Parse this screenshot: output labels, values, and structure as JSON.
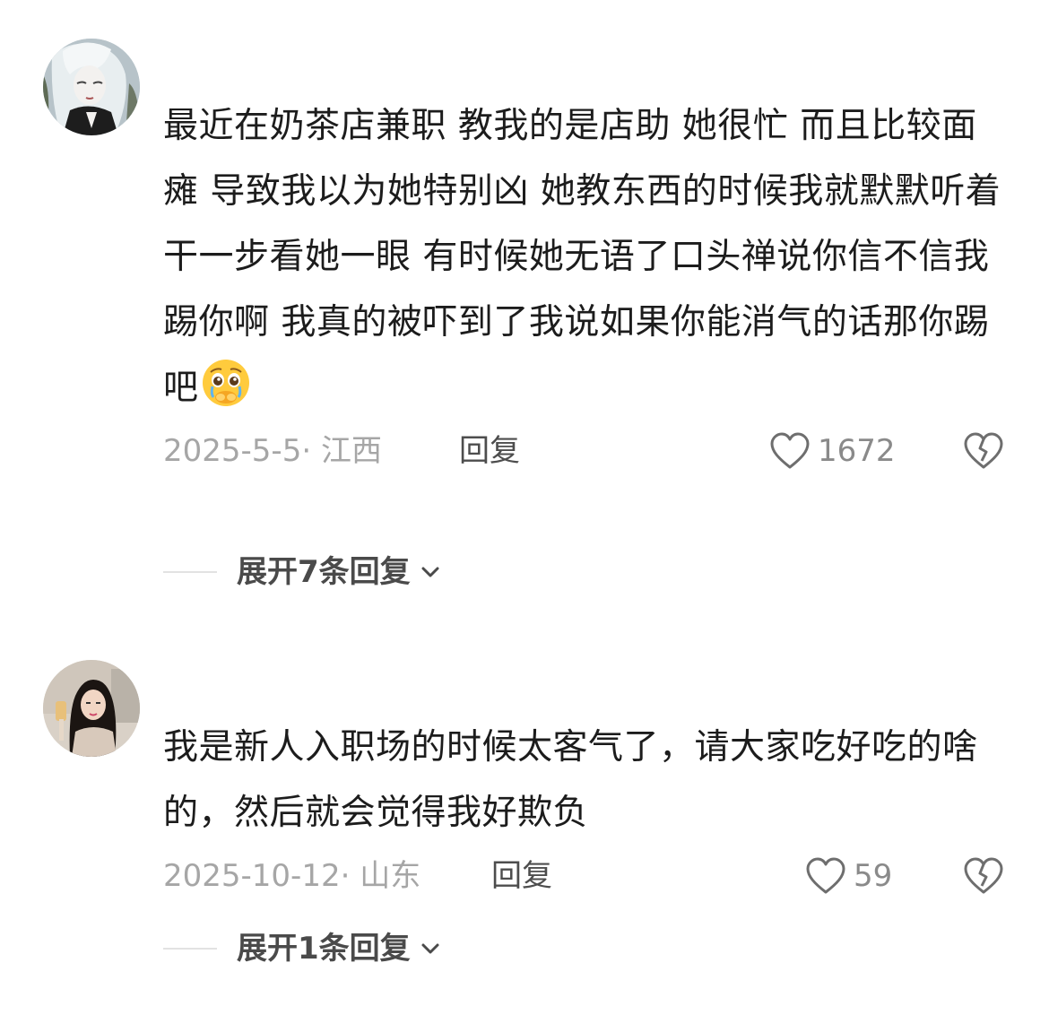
{
  "comments": [
    {
      "avatar": "anime-girl-avatar",
      "text": "最近在奶茶店兼职 教我的是店助 她很忙 而且比较面瘫 导致我以为她特别凶 她教东西的时候我就默默听着 干一步看她一眼 有时候她无语了口头禅说你信不信我踢你啊 我真的被吓到了我说如果你能消气的话那你踢吧",
      "emoji": "pleading-face-emoji",
      "date": "2025-5-5",
      "location": "江西",
      "date_location": "2025-5-5· 江西",
      "reply_label": "回复",
      "like_count": "1672",
      "expand_label": "展开7条回复"
    },
    {
      "avatar": "girl-photo-avatar",
      "text": "我是新人入职场的时候太客气了，请大家吃好吃的啥的，然后就会觉得我好欺负",
      "date": "2025-10-12",
      "location": "山东",
      "date_location": "2025-10-12· 山东",
      "reply_label": "回复",
      "like_count": "59",
      "expand_label": "展开1条回复"
    }
  ],
  "icons": {
    "like": "heart-icon",
    "dislike": "broken-heart-icon",
    "expand": "chevron-down-icon"
  },
  "colors": {
    "text": "#1c1c1c",
    "meta": "#a6a6a6",
    "reply": "#4d4d4d",
    "count": "#8a8a8a",
    "divider": "#e2e2e2"
  }
}
